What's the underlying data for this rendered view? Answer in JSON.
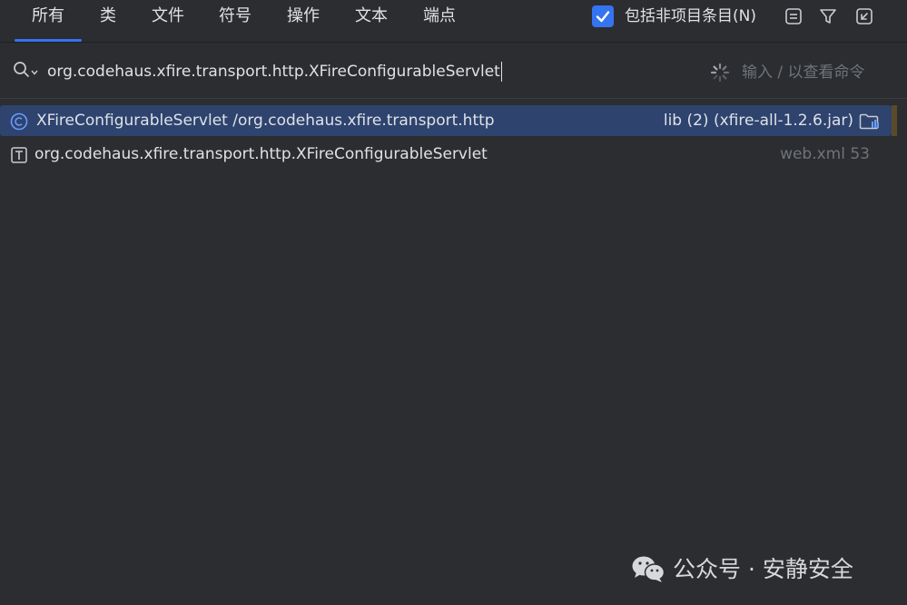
{
  "tabs": [
    {
      "label": "所有",
      "active": true
    },
    {
      "label": "类"
    },
    {
      "label": "文件"
    },
    {
      "label": "符号"
    },
    {
      "label": "操作"
    },
    {
      "label": "文本"
    },
    {
      "label": "端点"
    }
  ],
  "toolbar": {
    "include_non_project_label": "包括非项目条目(N)",
    "include_non_project_checked": true,
    "icons": [
      "preview-icon",
      "filter-icon",
      "open-in-window-icon"
    ]
  },
  "search": {
    "value": "org.codehaus.xfire.transport.http.XFireConfigurableServlet",
    "hint": "输入 / 以查看命令"
  },
  "results": [
    {
      "icon": "class-icon",
      "name": "XFireConfigurableServlet /org.codehaus.xfire.transport.http",
      "location": "lib (2) (xfire-all-1.2.6.jar)",
      "location_icon": "library-folder-icon",
      "selected": true
    },
    {
      "icon": "text-icon",
      "name": "org.codehaus.xfire.transport.http.XFireConfigurableServlet",
      "location": "web.xml 53",
      "selected": false
    }
  ],
  "watermark": {
    "text": "公众号 · 安静安全",
    "logo": "wechat-icon"
  },
  "colors": {
    "background": "#2b2d30",
    "accent": "#3574f0",
    "selection": "#2e436e",
    "muted_text": "#6f737a"
  }
}
